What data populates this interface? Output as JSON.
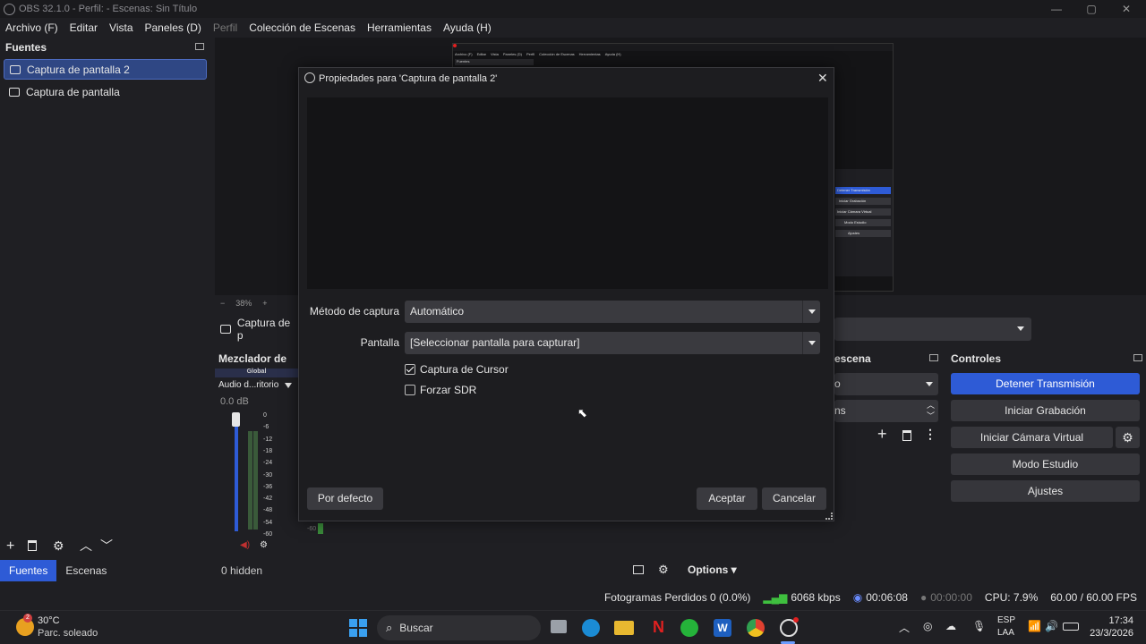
{
  "window": {
    "title": "OBS 32.1.0 - Perfil: - Escenas: Sin Título"
  },
  "menu": [
    {
      "label": "Archivo (F)",
      "dim": false
    },
    {
      "label": "Editar",
      "dim": false
    },
    {
      "label": "Vista",
      "dim": false
    },
    {
      "label": "Paneles (D)",
      "dim": false
    },
    {
      "label": "Perfil",
      "dim": true
    },
    {
      "label": "Colección de Escenas",
      "dim": false
    },
    {
      "label": "Herramientas",
      "dim": false
    },
    {
      "label": "Ayuda (H)",
      "dim": false
    }
  ],
  "sources": {
    "title": "Fuentes",
    "items": [
      {
        "label": "Captura de pantalla 2",
        "selected": true
      },
      {
        "label": "Captura de pantalla",
        "selected": false
      }
    ]
  },
  "preview": {
    "zoom": "38%",
    "source_label": "Captura de p",
    "hidden_count": "0 hidden",
    "options_label": "Options"
  },
  "mixer": {
    "title": "Mezclador de au",
    "global_label": "Global",
    "device": "Audio d...ritorio",
    "db": "0.0 dB",
    "ticks": [
      "0",
      "-6",
      "-12",
      "-18",
      "-24",
      "-30",
      "-36",
      "-42",
      "-48",
      "-54",
      "-60"
    ],
    "small_tick": "-60"
  },
  "scenes_dock": {
    "title": "escena",
    "field1": "o",
    "field2": "ns"
  },
  "controls": {
    "title": "Controles",
    "buttons": [
      {
        "label": "Detener Transmisión",
        "primary": true
      },
      {
        "label": "Iniciar Grabación",
        "primary": false
      },
      {
        "label": "Iniciar Cámara Virtual",
        "primary": false
      },
      {
        "label": "Modo Estudio",
        "primary": false
      },
      {
        "label": "Ajustes",
        "primary": false
      }
    ]
  },
  "tabs": [
    {
      "label": "Fuentes",
      "active": true
    },
    {
      "label": "Escenas",
      "active": false
    }
  ],
  "status": {
    "dropped": "Fotogramas Perdidos 0 (0.0%)",
    "kbps": "6068 kbps",
    "stream_time": "00:06:08",
    "rec_time": "00:00:00",
    "cpu": "CPU: 7.9%",
    "fps": "60.00 / 60.00 FPS"
  },
  "dialog": {
    "title": "Propiedades para 'Captura de pantalla 2'",
    "capture_method_label": "Método de captura",
    "capture_method_value": "Automático",
    "screen_label": "Pantalla",
    "screen_value": "[Seleccionar pantalla para capturar]",
    "cursor_capture": {
      "label": "Captura de Cursor",
      "checked": true
    },
    "force_sdr": {
      "label": "Forzar SDR",
      "checked": false
    },
    "defaults_button": "Por defecto",
    "ok_button": "Aceptar",
    "cancel_button": "Cancelar"
  },
  "nested_preview": {
    "menu": [
      "Archivo (F)",
      "Editar",
      "Vista",
      "Paneles (D)",
      "Perfil",
      "Colección de Escenas",
      "Herramientas",
      "Ayuda (H)"
    ],
    "fuentes": "Fuentes",
    "buttons": [
      "Detener Transmisión",
      "Iniciar Grabación",
      "Iniciar Cámara Virtual",
      "Modo Estudio",
      "Ajustes"
    ]
  },
  "taskbar": {
    "weather_temp": "30°C",
    "weather_desc": "Parc. soleado",
    "weather_badge": "2",
    "search": "Buscar",
    "lang": "ESP",
    "lang_sub": "LAA",
    "time": "17:34",
    "date": "23/3/2026"
  },
  "colors": {
    "accent": "#2e5bd6",
    "selection": "#2f4784",
    "background": "#1f1f23"
  }
}
